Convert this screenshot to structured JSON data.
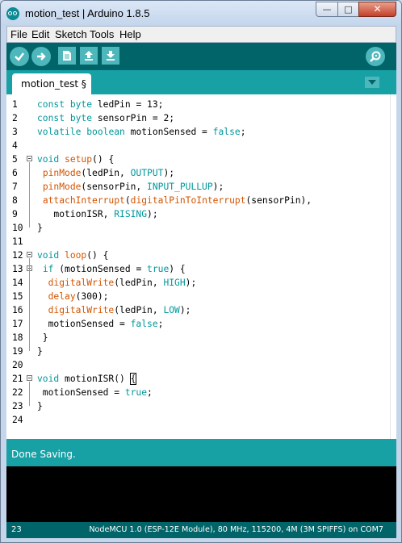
{
  "window": {
    "title": "motion_test | Arduino 1.8.5"
  },
  "menu": [
    "File",
    "Edit",
    "Sketch",
    "Tools",
    "Help"
  ],
  "tabs": [
    {
      "label": "motion_test §"
    }
  ],
  "editor": {
    "lines": [
      {
        "n": "1",
        "tokens": [
          [
            "kw",
            "const"
          ],
          [
            "",
            "  "
          ],
          [
            "kw",
            "byte"
          ],
          [
            "",
            "  ledPin = 13;"
          ]
        ]
      },
      {
        "n": "2",
        "tokens": [
          [
            "kw",
            "const"
          ],
          [
            "",
            "  "
          ],
          [
            "kw",
            "byte"
          ],
          [
            "",
            "  sensorPin = 2;"
          ]
        ]
      },
      {
        "n": "3",
        "tokens": [
          [
            "kw",
            "volatile"
          ],
          [
            "",
            "  "
          ],
          [
            "kw",
            "boolean"
          ],
          [
            "",
            "  motionSensed = "
          ],
          [
            "lit",
            "false"
          ],
          [
            "",
            ";"
          ]
        ]
      },
      {
        "n": "4",
        "tokens": []
      },
      {
        "n": "5",
        "fold": true,
        "tokens": [
          [
            "kw",
            "void"
          ],
          [
            "",
            "  "
          ],
          [
            "fn",
            "setup"
          ],
          [
            "",
            "() {"
          ]
        ]
      },
      {
        "n": "6",
        "tokens": [
          [
            "",
            "  "
          ],
          [
            "fn",
            "pinMode"
          ],
          [
            "",
            "(ledPin, "
          ],
          [
            "lit",
            "OUTPUT"
          ],
          [
            "",
            ");"
          ]
        ]
      },
      {
        "n": "7",
        "tokens": [
          [
            "",
            "  "
          ],
          [
            "fn",
            "pinMode"
          ],
          [
            "",
            "(sensorPin, "
          ],
          [
            "lit",
            "INPUT_PULLUP"
          ],
          [
            "",
            ");"
          ]
        ]
      },
      {
        "n": "8",
        "tokens": [
          [
            "",
            "  "
          ],
          [
            "fn",
            "attachInterrupt"
          ],
          [
            "",
            "("
          ],
          [
            "fn",
            "digitalPinToInterrupt"
          ],
          [
            "",
            "(sensorPin),"
          ]
        ]
      },
      {
        "n": "9",
        "tokens": [
          [
            "",
            "      motionISR, "
          ],
          [
            "lit",
            "RISING"
          ],
          [
            "",
            ");"
          ]
        ]
      },
      {
        "n": "10",
        "tokens": [
          [
            "",
            "}"
          ]
        ]
      },
      {
        "n": "11",
        "tokens": []
      },
      {
        "n": "12",
        "fold": true,
        "tokens": [
          [
            "kw",
            "void"
          ],
          [
            "",
            "  "
          ],
          [
            "fn",
            "loop"
          ],
          [
            "",
            "() {"
          ]
        ]
      },
      {
        "n": "13",
        "fold": true,
        "tokens": [
          [
            "",
            "  "
          ],
          [
            "kw",
            "if"
          ],
          [
            "",
            "  (motionSensed = "
          ],
          [
            "lit",
            "true"
          ],
          [
            "",
            ") {"
          ]
        ]
      },
      {
        "n": "14",
        "tokens": [
          [
            "",
            "    "
          ],
          [
            "fn",
            "digitalWrite"
          ],
          [
            "",
            "(ledPin, "
          ],
          [
            "lit",
            "HIGH"
          ],
          [
            "",
            ");"
          ]
        ]
      },
      {
        "n": "15",
        "tokens": [
          [
            "",
            "    "
          ],
          [
            "fn",
            "delay"
          ],
          [
            "",
            "(300);"
          ]
        ]
      },
      {
        "n": "16",
        "tokens": [
          [
            "",
            "    "
          ],
          [
            "fn",
            "digitalWrite"
          ],
          [
            "",
            "(ledPin, "
          ],
          [
            "lit",
            "LOW"
          ],
          [
            "",
            ");"
          ]
        ]
      },
      {
        "n": "17",
        "tokens": [
          [
            "",
            "    motionSensed = "
          ],
          [
            "lit",
            "false"
          ],
          [
            "",
            ";"
          ]
        ]
      },
      {
        "n": "18",
        "tokens": [
          [
            "",
            "  }"
          ]
        ]
      },
      {
        "n": "19",
        "tokens": [
          [
            "",
            "}"
          ]
        ]
      },
      {
        "n": "20",
        "tokens": []
      },
      {
        "n": "21",
        "fold": true,
        "tokens": [
          [
            "kw",
            "void"
          ],
          [
            "",
            "  motionISR() "
          ],
          [
            "brk",
            "{"
          ]
        ]
      },
      {
        "n": "22",
        "tokens": [
          [
            "",
            "  motionSensed = "
          ],
          [
            "lit",
            "true"
          ],
          [
            "",
            ";"
          ]
        ]
      },
      {
        "n": "23",
        "tokens": [
          [
            "",
            "}"
          ]
        ]
      },
      {
        "n": "24",
        "tokens": []
      }
    ]
  },
  "status": {
    "message": "Done Saving."
  },
  "footer": {
    "line_number": "23",
    "board": "NodeMCU 1.0 (ESP-12E Module), 80 MHz, 115200, 4M (3M SPIFFS) on COM7"
  },
  "icons": {
    "app": "arduino-logo-icon",
    "verify": "checkmark-icon",
    "upload": "arrow-right-icon",
    "new": "new-file-icon",
    "open": "open-arrow-up-icon",
    "save": "save-arrow-down-icon",
    "monitor": "serial-monitor-icon"
  },
  "colors": {
    "toolbar": "#006468",
    "tabbar": "#17a1a5",
    "keyword": "#00979c",
    "function": "#d35400"
  }
}
